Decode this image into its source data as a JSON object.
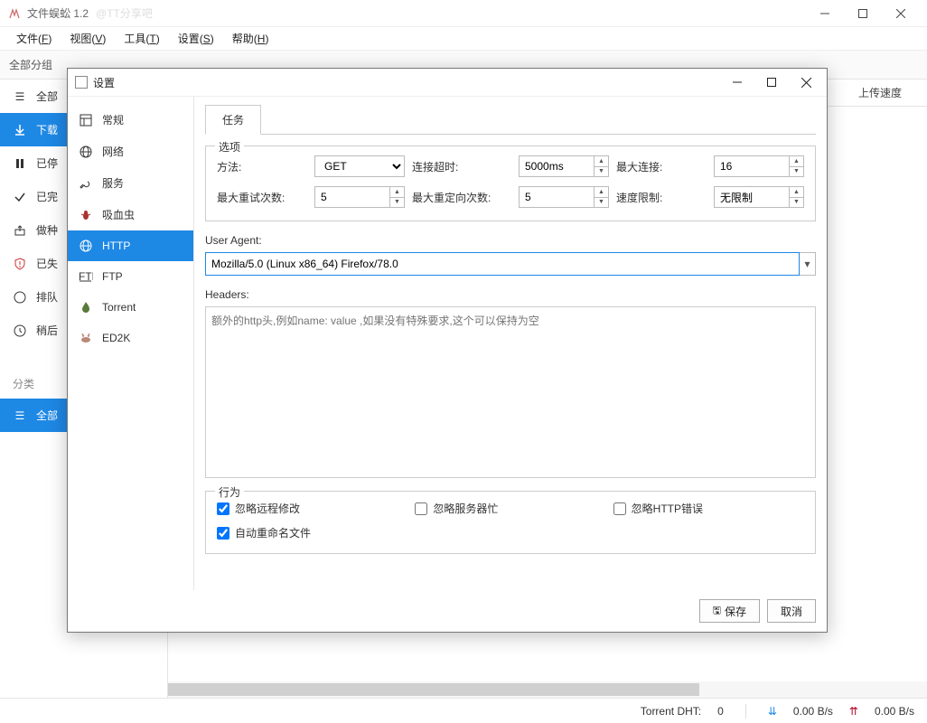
{
  "app": {
    "title": "文件蜈蚣 1.2",
    "watermark": "@TT分享吧"
  },
  "menubar": [
    {
      "label": "文件",
      "hotkey": "F"
    },
    {
      "label": "视图",
      "hotkey": "V"
    },
    {
      "label": "工具",
      "hotkey": "T"
    },
    {
      "label": "设置",
      "hotkey": "S"
    },
    {
      "label": "帮助",
      "hotkey": "H"
    }
  ],
  "toolbar_group_label": "全部分组",
  "sidebar": {
    "items": [
      {
        "label": "全部",
        "icon": "menu"
      },
      {
        "label": "下载",
        "icon": "download",
        "active": true
      },
      {
        "label": "已停",
        "icon": "pause"
      },
      {
        "label": "已完",
        "icon": "check"
      },
      {
        "label": "做种",
        "icon": "upload-box"
      },
      {
        "label": "已失",
        "icon": "shield-alert"
      },
      {
        "label": "排队",
        "icon": "compass"
      },
      {
        "label": "稍后",
        "icon": "clock"
      }
    ],
    "category_label": "分类",
    "category_item": {
      "label": "全部",
      "icon": "menu"
    }
  },
  "content_columns": {
    "upload_speed": "上传速度"
  },
  "statusbar": {
    "torrent_dht_label": "Torrent DHT:",
    "torrent_dht_value": "0",
    "download_speed": "0.00 B/s",
    "upload_speed": "0.00 B/s"
  },
  "dialog": {
    "title": "设置",
    "sidebar": [
      {
        "label": "常规",
        "icon": "layout"
      },
      {
        "label": "网络",
        "icon": "globe"
      },
      {
        "label": "服务",
        "icon": "wrench"
      },
      {
        "label": "吸血虫",
        "icon": "bug"
      },
      {
        "label": "HTTP",
        "icon": "globe-solid",
        "active": true
      },
      {
        "label": "FTP",
        "icon": "ftp"
      },
      {
        "label": "Torrent",
        "icon": "flame"
      },
      {
        "label": "ED2K",
        "icon": "donkey"
      }
    ],
    "tabs": [
      {
        "label": "任务",
        "active": true
      }
    ],
    "options_title": "选项",
    "form": {
      "method_label": "方法:",
      "method_value": "GET",
      "timeout_label": "连接超时:",
      "timeout_value": "5000ms",
      "max_conn_label": "最大连接:",
      "max_conn_value": "16",
      "max_retry_label": "最大重试次数:",
      "max_retry_value": "5",
      "max_redirect_label": "最大重定向次数:",
      "max_redirect_value": "5",
      "speed_limit_label": "速度限制:",
      "speed_limit_value": "无限制"
    },
    "user_agent_label": "User Agent:",
    "user_agent_value": "Mozilla/5.0 (Linux x86_64) Firefox/78.0",
    "headers_label": "Headers:",
    "headers_placeholder": "额外的http头,例如name: value ,如果没有特殊要求,这个可以保持为空",
    "behavior_title": "行为",
    "behavior": {
      "ignore_remote_mod": {
        "label": "忽略远程修改",
        "checked": true
      },
      "ignore_server_busy": {
        "label": "忽略服务器忙",
        "checked": false
      },
      "ignore_http_error": {
        "label": "忽略HTTP错误",
        "checked": false
      },
      "auto_rename": {
        "label": "自动重命名文件",
        "checked": true
      }
    },
    "buttons": {
      "save": "保存",
      "cancel": "取消"
    }
  }
}
